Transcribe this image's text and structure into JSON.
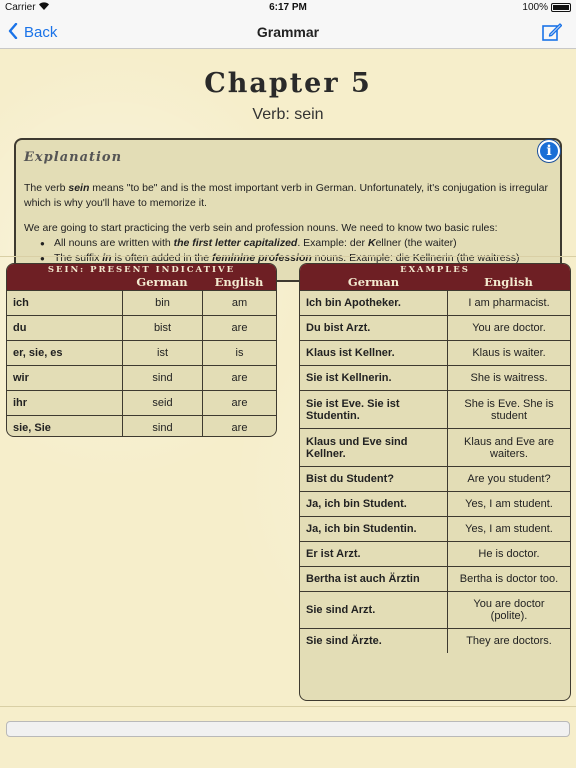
{
  "status": {
    "carrier": "Carrier",
    "time": "6:17 PM",
    "battery": "100%"
  },
  "nav": {
    "back_label": "Back",
    "title": "Grammar"
  },
  "chapter": {
    "title": "Chapter 5",
    "subtitle": "Verb: sein"
  },
  "explanation": {
    "heading": "Explanation",
    "p1_a": "The verb ",
    "p1_b": "sein",
    "p1_c": " means \"to be\" and is the most important verb in German. Unfortunately, it's conjugation is irregular which is why you'll have to memorize it.",
    "p2": "We are going to start practicing the verb sein and profession nouns. We need to know two basic rules:",
    "rule1_a": "All nouns are written with ",
    "rule1_b": "the first letter capitalized",
    "rule1_c": ". Example: der ",
    "rule1_d": "K",
    "rule1_e": "ellner (the waiter)",
    "rule2_a": "The suffix ",
    "rule2_b": "in",
    "rule2_c": " is often added in the ",
    "rule2_d": "feminine profession",
    "rule2_e": " nouns. Example: die Kellnerin (the waitress)"
  },
  "sein_table": {
    "caption": "SEIN: PRESENT INDICATIVE",
    "col_german": "German",
    "col_english": "English",
    "rows": [
      {
        "pronoun": "ich",
        "german": "bin",
        "english": "am"
      },
      {
        "pronoun": "du",
        "german": "bist",
        "english": "are"
      },
      {
        "pronoun": "er, sie, es",
        "german": "ist",
        "english": "is"
      },
      {
        "pronoun": "wir",
        "german": "sind",
        "english": "are"
      },
      {
        "pronoun": "ihr",
        "german": "seid",
        "english": "are"
      },
      {
        "pronoun": "sie, Sie",
        "german": "sind",
        "english": "are"
      }
    ]
  },
  "examples_table": {
    "caption": "EXAMPLES",
    "col_german": "German",
    "col_english": "English",
    "rows": [
      {
        "german": "Ich bin Apotheker.",
        "english": "I am pharmacist."
      },
      {
        "german": "Du bist Arzt.",
        "english": "You are doctor."
      },
      {
        "german": "Klaus ist Kellner.",
        "english": "Klaus is waiter."
      },
      {
        "german": "Sie ist Kellnerin.",
        "english": "She is waitress."
      },
      {
        "german": "Sie ist Eve. Sie ist Studentin.",
        "english": "She is Eve. She is student"
      },
      {
        "german": "Klaus und Eve sind Kellner.",
        "english": "Klaus and Eve are waiters."
      },
      {
        "german": "Bist du Student?",
        "english": "Are you student?"
      },
      {
        "german": "Ja, ich bin Student.",
        "english": "Yes, I am student."
      },
      {
        "german": "Ja, ich bin Studentin.",
        "english": "Yes, I am student."
      },
      {
        "german": "Er ist Arzt.",
        "english": "He is doctor."
      },
      {
        "german": "Bertha ist auch Ärztin",
        "english": "Bertha is doctor too."
      },
      {
        "german": "Sie sind Arzt.",
        "english": "You are doctor (polite)."
      },
      {
        "german": "Sie sind Ärzte.",
        "english": "They are doctors."
      }
    ]
  }
}
